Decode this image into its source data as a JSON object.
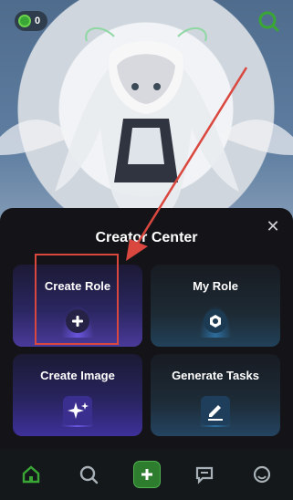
{
  "header": {
    "coins": "0"
  },
  "sheet": {
    "title": "Creator Center"
  },
  "cards": [
    {
      "label": "Create Role",
      "icon": "plus-icon"
    },
    {
      "label": "My Role",
      "icon": "hexagon-icon"
    },
    {
      "label": "Create Image",
      "icon": "sparkle-icon"
    },
    {
      "label": "Generate Tasks",
      "icon": "pencil-icon"
    }
  ],
  "nav": [
    "home-icon",
    "search-icon",
    "add-icon",
    "chat-icon",
    "profile-icon"
  ],
  "colors": {
    "accent": "#3aa635",
    "annotation": "#d9473f"
  }
}
